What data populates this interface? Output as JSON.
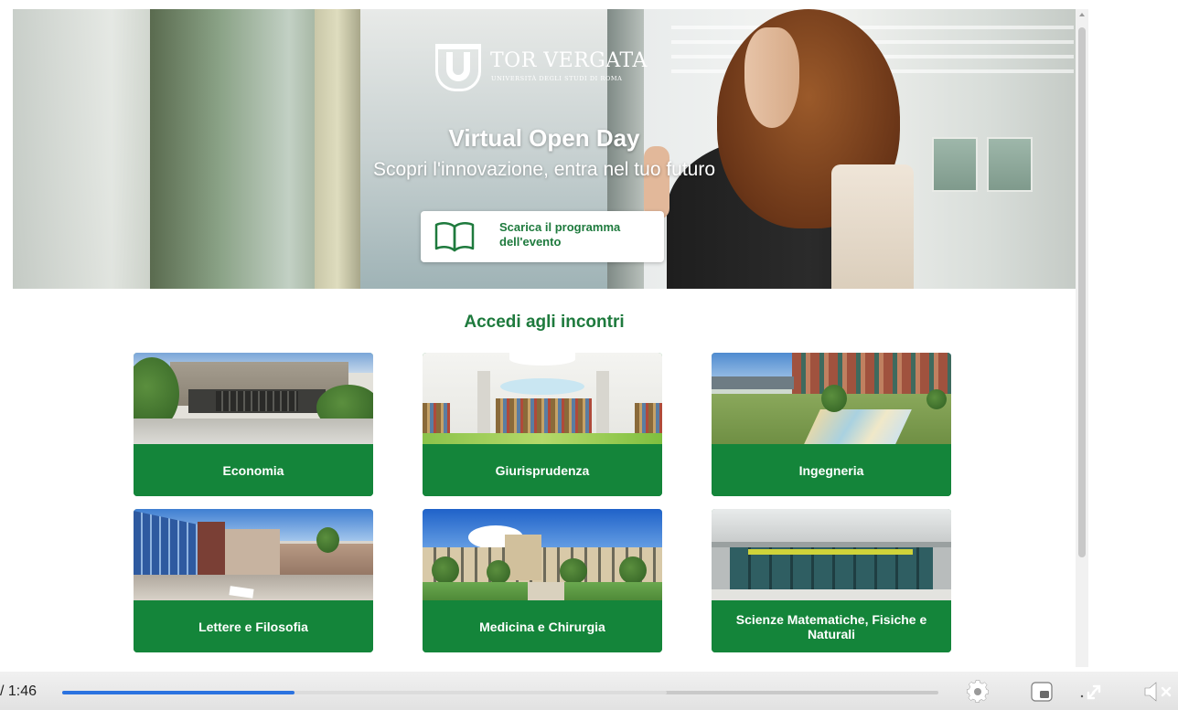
{
  "hero": {
    "logo_name": "TOR VERGATA",
    "logo_sub": "UNIVERSITÀ DEGLI STUDI DI ROMA",
    "title": "Virtual Open Day",
    "subtitle": "Scopri l'innovazione, entra nel tuo futuro",
    "download_label": "Scarica il programma dell'evento"
  },
  "section": {
    "title": "Accedi agli incontri"
  },
  "faculties": [
    {
      "label": "Economia"
    },
    {
      "label": "Giurisprudenza"
    },
    {
      "label": "Ingegneria"
    },
    {
      "label": "Lettere e Filosofia"
    },
    {
      "label": "Medicina e Chirurgia"
    },
    {
      "label": "Scienze Matematiche, Fisiche e Naturali"
    }
  ],
  "player": {
    "time_text": "/ 1:46",
    "progress_fraction": 0.265,
    "buffered_fraction": 0.69
  },
  "colors": {
    "brand_green": "#14853a",
    "title_green": "#1e7a3d",
    "progress_blue": "#2b73e0"
  },
  "icons": [
    "book-icon",
    "settings-gear-icon",
    "picture-in-picture-icon",
    "fullscreen-icon",
    "volume-muted-icon"
  ]
}
